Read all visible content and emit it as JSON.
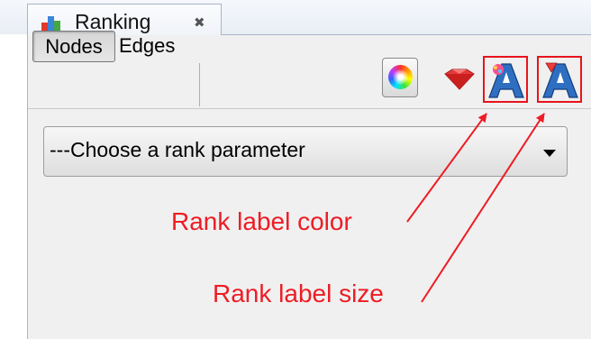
{
  "tab": {
    "title": "Ranking",
    "icon": "ranking-icon",
    "close_icon": "close-icon"
  },
  "toolbar": {
    "nodes_label": "Nodes",
    "edges_label": "Edges",
    "selected": "Nodes",
    "buttons": [
      "color-wheel-icon",
      "gem-icon",
      "label-color-icon",
      "label-size-icon"
    ]
  },
  "combo": {
    "value": "---Choose a rank parameter"
  },
  "annotations": {
    "label_color": "Rank label color",
    "label_size": "Rank label size",
    "color": "#ee1c24"
  }
}
